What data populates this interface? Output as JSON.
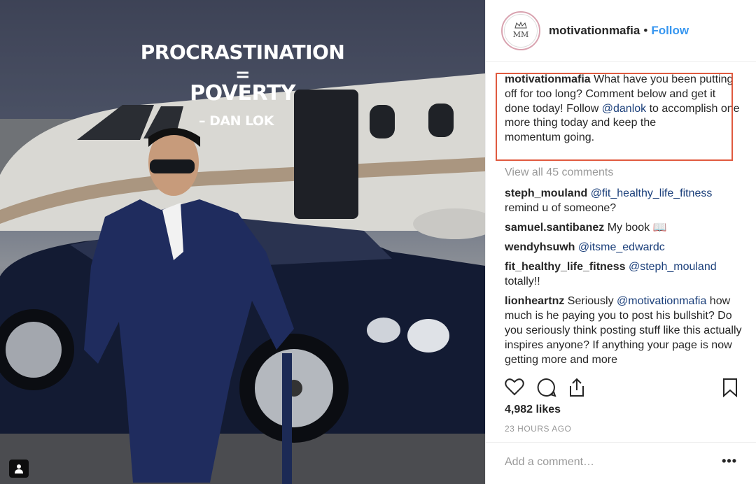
{
  "post_image": {
    "headline": "PROCRASTINATION",
    "equals": "=",
    "result": "POVERTY",
    "author": "– DAN LOK"
  },
  "header": {
    "username": "motivationmafia",
    "separator": "•",
    "follow_label": "Follow",
    "avatar_monogram": "MM"
  },
  "caption": {
    "username": "motivationmafia",
    "text_1": " What have you been putting off for too long? Comment below and get it done today! Follow ",
    "mention": "@danlok",
    "text_2": " to accomplish one more thing today and keep the",
    "text_3": "momentum going."
  },
  "view_all": "View all 45 comments",
  "comments": [
    {
      "username": "steph_mouland",
      "mention": "@fit_healthy_life_fitness",
      "text": " remind u of someone?"
    },
    {
      "username": "samuel.santibanez",
      "mention": "",
      "text": " My book 📖"
    },
    {
      "username": "wendyhsuwh",
      "mention": "@itsme_edwardc",
      "text": ""
    },
    {
      "username": "fit_healthy_life_fitness",
      "mention": "@steph_mouland",
      "text": " totally!!"
    },
    {
      "username": "lionheartnz",
      "mention": "",
      "text_pre": " Seriously ",
      "mention2": "@motivationmafia",
      "text": " how much is he paying you to post his bullshit? Do you seriously think posting stuff like this actually inspires anyone? If anything your page is now getting more and more"
    }
  ],
  "likes": "4,982 likes",
  "timestamp": "23 HOURS AGO",
  "add_comment_placeholder": "Add a comment…",
  "more_label": "•••",
  "colors": {
    "follow_blue": "#3897f0",
    "mention_blue": "#1b3f7a",
    "highlight_box": "#e05a3f"
  },
  "icons": [
    "heart-icon",
    "comment-icon",
    "share-icon",
    "bookmark-icon",
    "tagged-user-icon"
  ]
}
